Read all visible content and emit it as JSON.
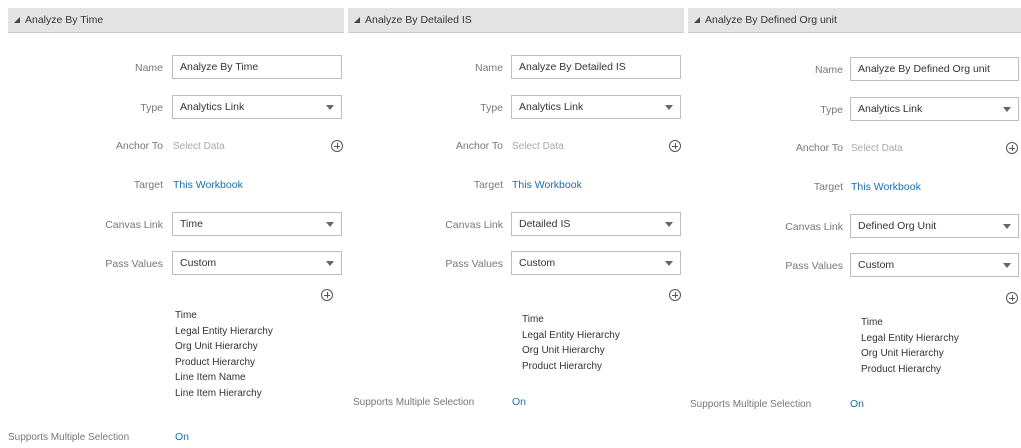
{
  "panels": [
    {
      "title": "Analyze By Time",
      "name_label": "Name",
      "name_value": "Analyze By Time",
      "type_label": "Type",
      "type_value": "Analytics Link",
      "anchor_label": "Anchor To",
      "anchor_placeholder": "Select Data",
      "target_label": "Target",
      "target_value": "This Workbook",
      "canvas_label": "Canvas Link",
      "canvas_value": "Time",
      "pass_label": "Pass Values",
      "pass_value": "Custom",
      "values": [
        "Time",
        "Legal Entity Hierarchy",
        "Org Unit Hierarchy",
        "Product Hierarchy",
        "Line Item Name",
        "Line Item Hierarchy"
      ],
      "sms_label": "Supports Multiple Selection",
      "sms_value": "On"
    },
    {
      "title": "Analyze By Detailed IS",
      "name_label": "Name",
      "name_value": "Analyze By Detailed IS",
      "type_label": "Type",
      "type_value": "Analytics Link",
      "anchor_label": "Anchor To",
      "anchor_placeholder": "Select Data",
      "target_label": "Target",
      "target_value": "This Workbook",
      "canvas_label": "Canvas Link",
      "canvas_value": "Detailed IS",
      "pass_label": "Pass Values",
      "pass_value": "Custom",
      "values": [
        "Time",
        "Legal Entity Hierarchy",
        "Org Unit Hierarchy",
        "Product Hierarchy"
      ],
      "sms_label": "Supports Multiple Selection",
      "sms_value": "On"
    },
    {
      "title": "Analyze By Defined Org unit",
      "name_label": "Name",
      "name_value": "Analyze By Defined Org unit",
      "type_label": "Type",
      "type_value": "Analytics Link",
      "anchor_label": "Anchor To",
      "anchor_placeholder": "Select Data",
      "target_label": "Target",
      "target_value": "This Workbook",
      "canvas_label": "Canvas Link",
      "canvas_value": "Defined Org Unit",
      "pass_label": "Pass Values",
      "pass_value": "Custom",
      "values": [
        "Time",
        "Legal Entity Hierarchy",
        "Org Unit Hierarchy",
        "Product Hierarchy"
      ],
      "sms_label": "Supports Multiple Selection",
      "sms_value": "On"
    }
  ],
  "icons": {
    "expand": "collapse-triangle-icon",
    "caret": "chevron-down-icon",
    "add": "add-circle-icon"
  },
  "colors": {
    "header_bg": "#e3e3e3",
    "link": "#1a6fa8",
    "label": "#777777",
    "placeholder": "#a8a8a8"
  }
}
